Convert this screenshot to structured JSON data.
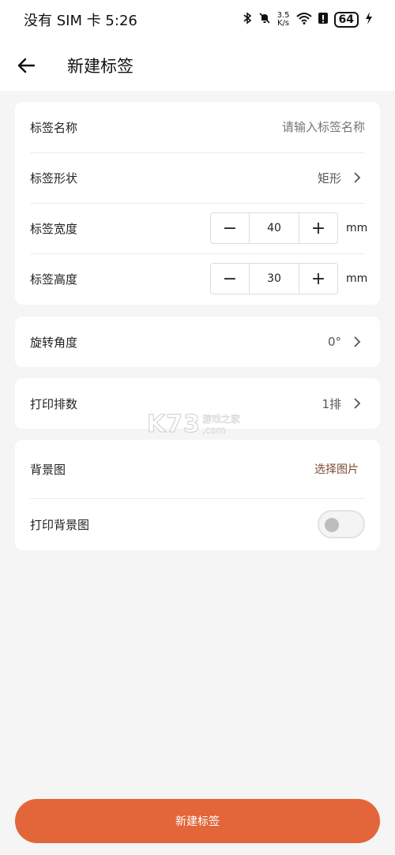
{
  "status_bar": {
    "carrier_time": "没有 SIM 卡 5:26",
    "net_speed_value": "3.5",
    "net_speed_unit": "K/s",
    "battery": "64"
  },
  "header": {
    "title": "新建标签"
  },
  "form": {
    "name_label": "标签名称",
    "name_placeholder": "请输入标签名称",
    "shape_label": "标签形状",
    "shape_value": "矩形",
    "width_label": "标签宽度",
    "width_value": "40",
    "height_label": "标签高度",
    "height_value": "30",
    "unit": "mm",
    "minus_symbol": "−",
    "plus_symbol": "+"
  },
  "rotation": {
    "label": "旋转角度",
    "value": "0°"
  },
  "print_rows": {
    "label": "打印排数",
    "value": "1排"
  },
  "background": {
    "label": "背景图",
    "action": "选择图片",
    "print_label": "打印背景图",
    "print_enabled": false
  },
  "watermark": {
    "logo": "K73",
    "line1": "游戏之家",
    "line2": ".com"
  },
  "submit": {
    "label": "新建标签"
  },
  "colors": {
    "accent": "#e2663a",
    "link": "#7a4a36",
    "background": "#f5f5f5"
  }
}
